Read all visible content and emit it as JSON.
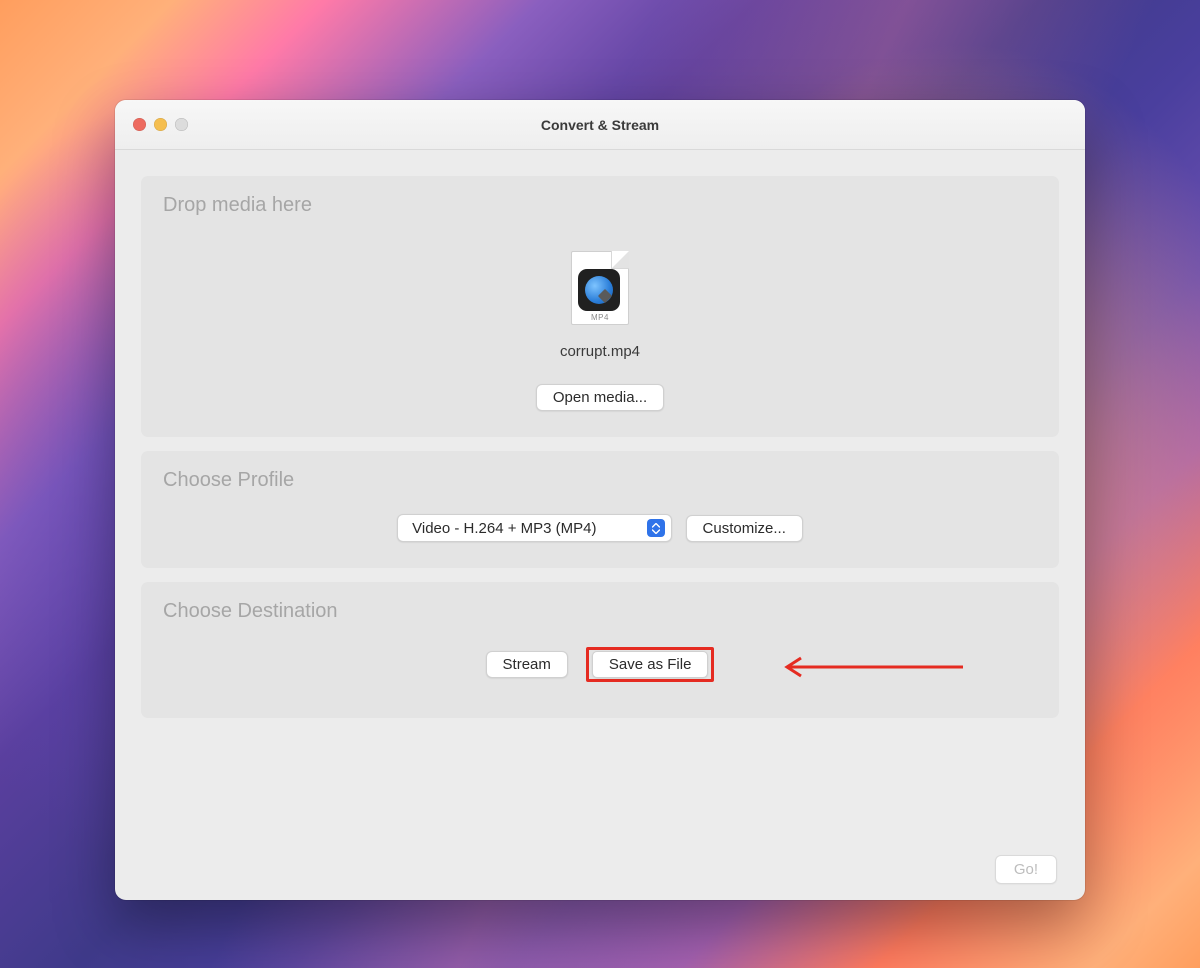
{
  "window": {
    "title": "Convert & Stream"
  },
  "drop": {
    "heading": "Drop media here",
    "file_ext": "MP4",
    "file_name": "corrupt.mp4",
    "open_button": "Open media..."
  },
  "profile": {
    "heading": "Choose Profile",
    "selected": "Video - H.264 + MP3 (MP4)",
    "customize_button": "Customize..."
  },
  "destination": {
    "heading": "Choose Destination",
    "stream_button": "Stream",
    "save_button": "Save as File"
  },
  "footer": {
    "go_button": "Go!"
  }
}
